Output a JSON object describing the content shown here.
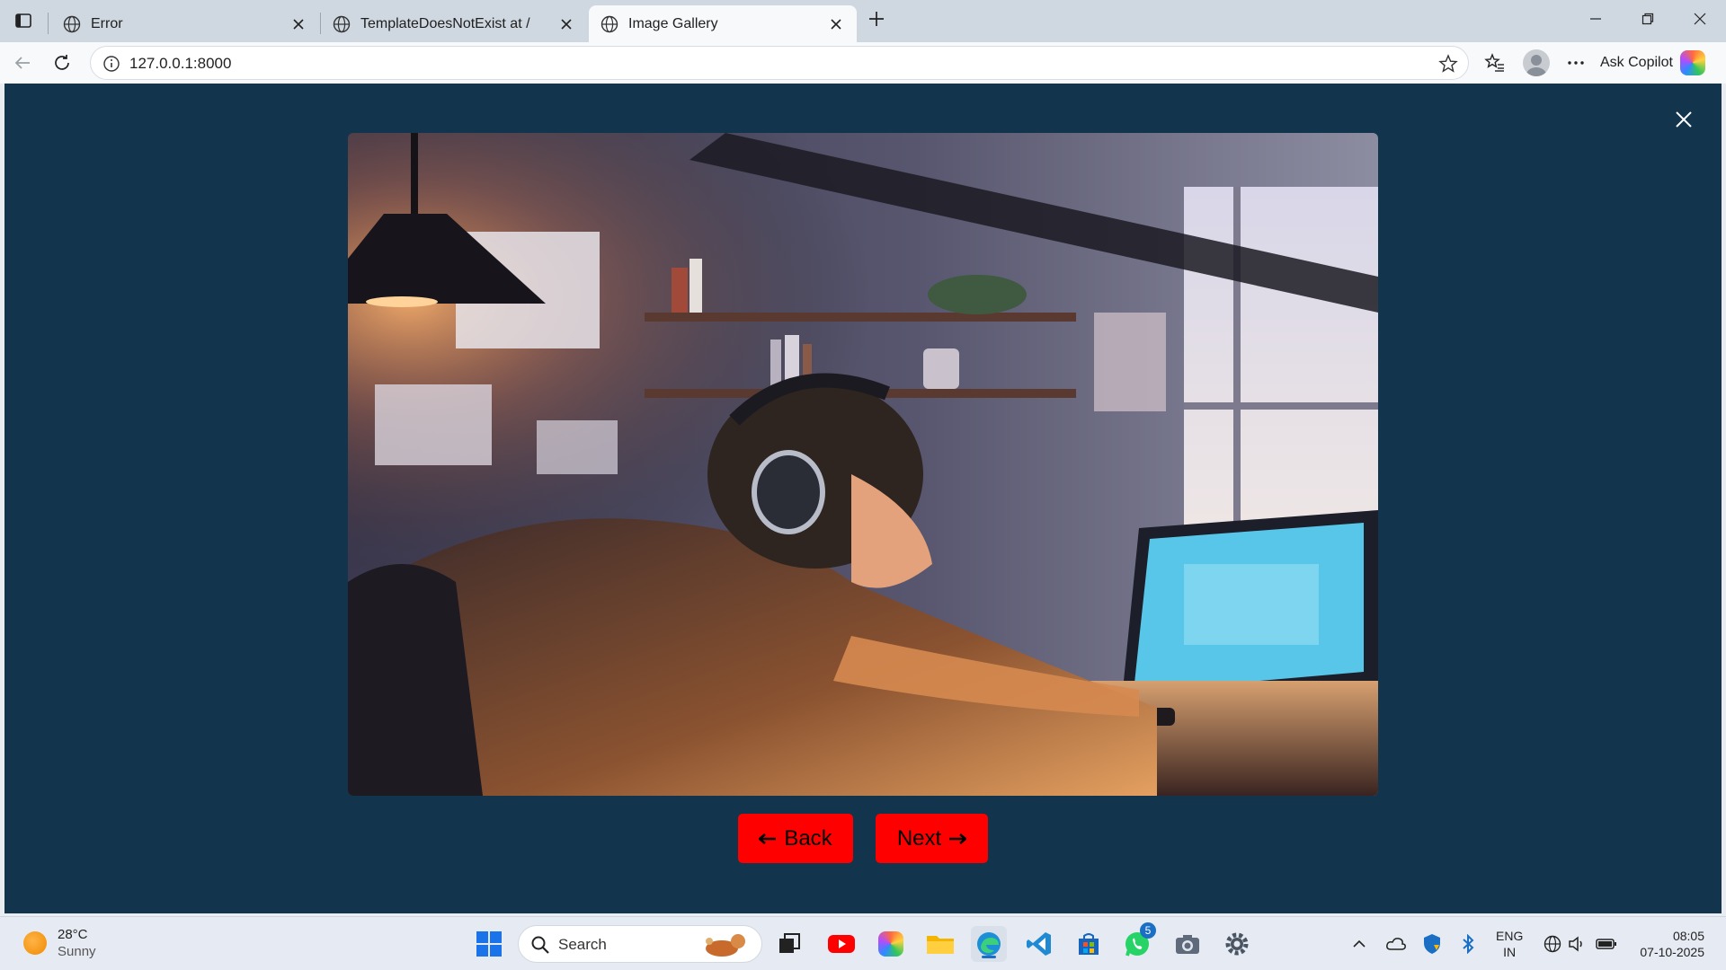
{
  "browser": {
    "tabs": [
      {
        "title": "Error",
        "active": false
      },
      {
        "title": "TemplateDoesNotExist at /",
        "active": false
      },
      {
        "title": "Image Gallery",
        "active": true
      }
    ],
    "address": "127.0.0.1:8000",
    "copilot_label": "Ask Copilot"
  },
  "gallery": {
    "back_label": "Back",
    "next_label": "Next",
    "image_alt": "anime-style illustration of a person wearing headphones working at a computer desk at night"
  },
  "taskbar": {
    "weather": {
      "temp": "28°C",
      "condition": "Sunny"
    },
    "search_placeholder": "Search",
    "whatsapp_badge": "5",
    "language": {
      "line1": "ENG",
      "line2": "IN"
    },
    "clock": {
      "time": "08:05",
      "date": "07-10-2025"
    }
  },
  "colors": {
    "page_bg": "#12344d",
    "button_bg": "#ff0000",
    "tabstrip_bg": "#cfd7e0"
  }
}
